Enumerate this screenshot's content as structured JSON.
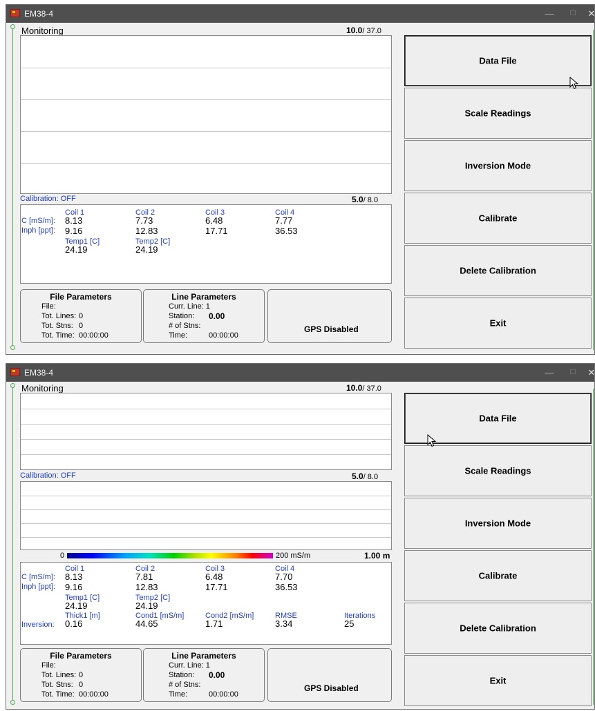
{
  "windows": [
    {
      "title": "EM38-4",
      "controls": {
        "minimize": "—",
        "maximize": "☐",
        "close": "✕"
      },
      "monitoring_label": "Monitoring",
      "top_ratio": {
        "current": "10.0",
        "max": "/ 37.0"
      },
      "calibration_label": "Calibration: OFF",
      "bottom_ratio": {
        "current": "5.0",
        "max": "/ 8.0"
      },
      "readings": {
        "coil_headers": [
          "Coil 1",
          "Coil 2",
          "Coil 3",
          "Coil 4"
        ],
        "c_label": "C [mS/m]:",
        "c_values": [
          "8.13",
          "7.73",
          "6.48",
          "7.77"
        ],
        "inph_label": "Inph [ppt]:",
        "inph_values": [
          "9.16",
          "12.83",
          "17.71",
          "36.53"
        ],
        "temp_headers": [
          "Temp1 [C]",
          "Temp2 [C]"
        ],
        "temp_values": [
          "24.19",
          "24.19"
        ]
      },
      "file_parameters": {
        "header": "File Parameters",
        "file_label": "File:",
        "tot_lines_label": "Tot. Lines:",
        "tot_lines": "0",
        "tot_stns_label": "Tot. Stns:",
        "tot_stns": "0",
        "tot_time_label": "Tot. Time:",
        "tot_time": "00:00:00"
      },
      "line_parameters": {
        "header": "Line Parameters",
        "curr_line": "Curr. Line: 1",
        "station_label": "Station:",
        "station": "0.00",
        "num_stns_label": "# of Stns:",
        "time_label": "Time:",
        "time": "00:00:00"
      },
      "gps": "GPS Disabled",
      "buttons": [
        "Data File",
        "Scale Readings",
        "Inversion Mode",
        "Calibrate",
        "Delete Calibration",
        "Exit"
      ]
    },
    {
      "title": "EM38-4",
      "controls": {
        "minimize": "—",
        "maximize": "☐",
        "close": "✕"
      },
      "monitoring_label": "Monitoring",
      "top_ratio": {
        "current": "10.0",
        "max": "/ 37.0"
      },
      "calibration_label": "Calibration: OFF",
      "bottom_ratio": {
        "current": "5.0",
        "max": "/ 8.0"
      },
      "colorbar": {
        "min": "0",
        "max": "200 mS/m",
        "depth": "1.00 m"
      },
      "readings": {
        "coil_headers": [
          "Coil 1",
          "Coil 2",
          "Coil 3",
          "Coil 4"
        ],
        "c_label": "C [mS/m]:",
        "c_values": [
          "8.13",
          "7.81",
          "6.48",
          "7.70"
        ],
        "inph_label": "Inph [ppt]:",
        "inph_values": [
          "9.16",
          "12.83",
          "17.71",
          "36.53"
        ],
        "temp_headers": [
          "Temp1 [C]",
          "Temp2 [C]"
        ],
        "temp_values": [
          "24.19",
          "24.19"
        ],
        "inversion_headers": [
          "Thick1 [m]",
          "Cond1 [mS/m]",
          "Cond2 [mS/m]",
          "RMSE",
          "Iterations"
        ],
        "inversion_label": "Inversion:",
        "inversion_values": [
          "0.16",
          "44.65",
          "1.71",
          "3.34",
          "25"
        ]
      },
      "file_parameters": {
        "header": "File Parameters",
        "file_label": "File:",
        "tot_lines_label": "Tot. Lines:",
        "tot_lines": "0",
        "tot_stns_label": "Tot. Stns:",
        "tot_stns": "0",
        "tot_time_label": "Tot. Time:",
        "tot_time": "00:00:00"
      },
      "line_parameters": {
        "header": "Line Parameters",
        "curr_line": "Curr. Line: 1",
        "station_label": "Station:",
        "station": "0.00",
        "num_stns_label": "# of Stns:",
        "time_label": "Time:",
        "time": "00:00:00"
      },
      "gps": "GPS Disabled",
      "buttons": [
        "Data File",
        "Scale Readings",
        "Inversion Mode",
        "Calibrate",
        "Delete Calibration",
        "Exit"
      ]
    }
  ]
}
